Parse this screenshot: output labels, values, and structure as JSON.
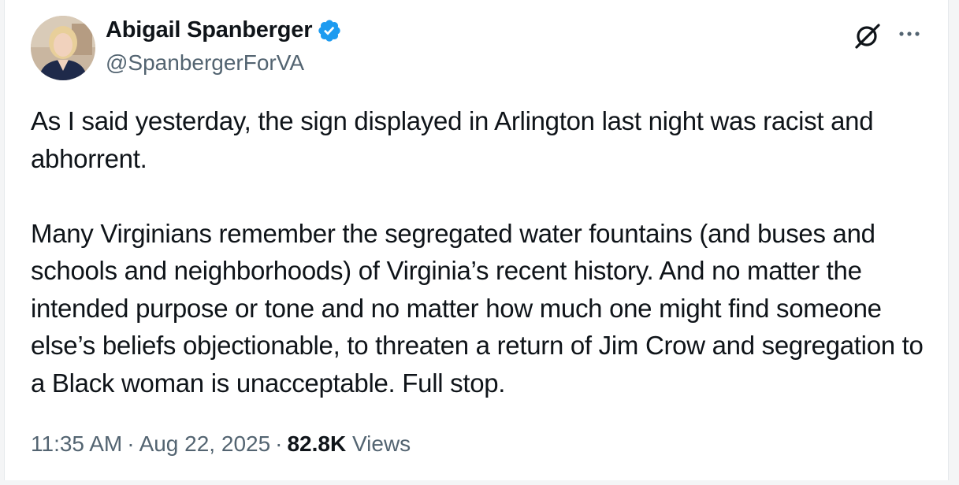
{
  "author": {
    "display_name": "Abigail Spanberger",
    "handle": "@SpanbergerForVA",
    "verified": true,
    "avatar_icon": "profile-photo"
  },
  "icons": {
    "grok": "grok-icon",
    "more": "more-icon"
  },
  "tweet": {
    "paragraphs": [
      "As I said yesterday, the sign displayed in Arlington last night was racist and abhorrent.",
      "Many Virginians remember the segregated water fountains (and buses and schools and neighborhoods) of Virginia’s recent history. And no matter the intended purpose or tone and no matter how much one might find someone else’s beliefs objectionable, to threaten a return of Jim Crow and segregation to a Black woman is unacceptable. Full stop."
    ]
  },
  "meta": {
    "time": "11:35 AM",
    "separator": "·",
    "date": "Aug 22, 2025",
    "views_count": "82.8K",
    "views_label": "Views"
  },
  "colors": {
    "text_primary": "#0f1419",
    "text_secondary": "#536471",
    "verified_blue": "#1d9bf0"
  }
}
